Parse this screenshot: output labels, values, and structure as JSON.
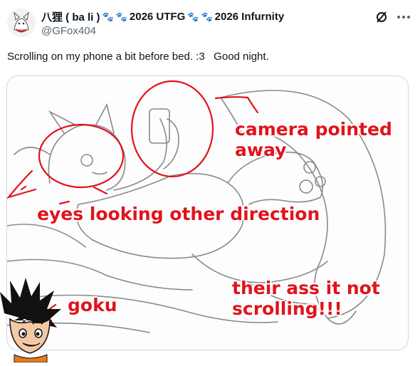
{
  "post": {
    "author": {
      "display_name": "八狸 ( ba li )",
      "badges": [
        "2026 UTFG",
        "2026 Infurnity"
      ],
      "handle": "@GFox404"
    },
    "text": "Scrolling on my phone a bit before bed. :3   Good night.",
    "icons": [
      "grok-icon",
      "more-options-icon",
      "paw-icon"
    ]
  },
  "annotations": {
    "camera": "camera pointed\naway",
    "eyes": "eyes looking other direction",
    "goku": "goku",
    "ass": "their ass it not\nscrolling!!!"
  },
  "colors": {
    "annotation": "#e0141c",
    "handle": "#536471",
    "border": "#cfd9de"
  }
}
